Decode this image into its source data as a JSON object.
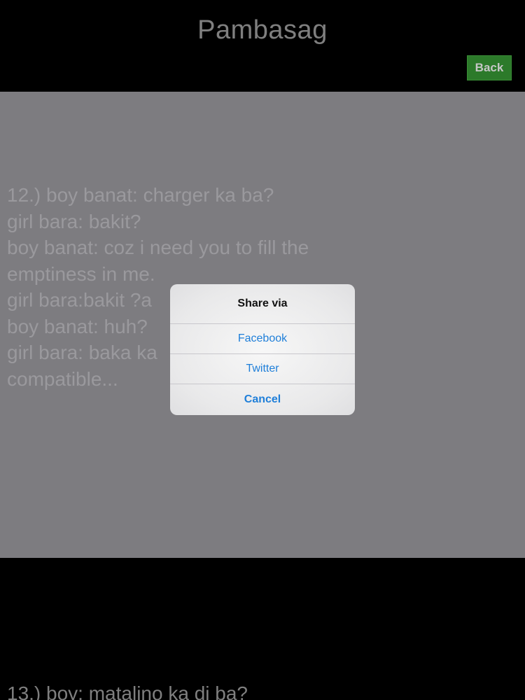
{
  "header": {
    "title": "Pambasag",
    "back_label": "Back"
  },
  "content": {
    "joke_text": "12.) boy banat: charger ka ba?\ngirl bara: bakit?\nboy banat: coz i need you to fill the emptiness in me.\ngirl bara:bakit ?a\nboy banat: huh?\ngirl bara: baka ka\ncompatible...",
    "next_joke_text": "13.) boy: matalino ka di ba?"
  },
  "share_dialog": {
    "title": "Share via",
    "options": [
      {
        "label": "Facebook"
      },
      {
        "label": "Twitter"
      }
    ],
    "cancel_label": "Cancel"
  },
  "colors": {
    "back_button": "#2c7a2a",
    "link": "#1f7fd9",
    "overlay": "#7d7c80"
  }
}
